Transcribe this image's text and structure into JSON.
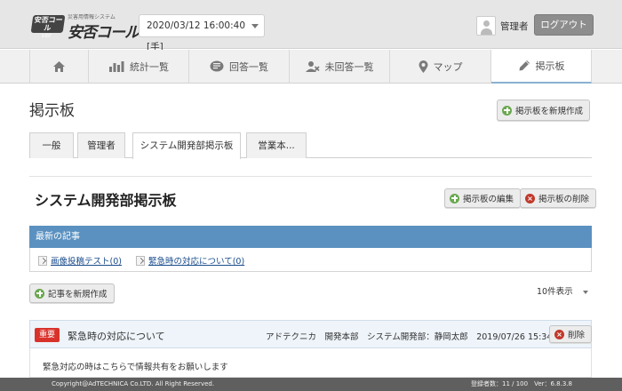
{
  "header": {
    "logo_sub": "災害用情報システム",
    "logo_badge_line1": "安否コール",
    "logo_badge_line2": "ver",
    "logo_main": "安否コール",
    "datetime": "2020/03/12 16:00:40 [手]",
    "user_name": "管理者",
    "logout_label": "ログアウト"
  },
  "nav": {
    "items": [
      {
        "label": "",
        "icon": "home-icon"
      },
      {
        "label": "統計一覧",
        "icon": "bar-chart-icon"
      },
      {
        "label": "回答一覧",
        "icon": "chat-icon"
      },
      {
        "label": "未回答一覧",
        "icon": "user-x-icon"
      },
      {
        "label": "マップ",
        "icon": "map-pin-icon"
      },
      {
        "label": "掲示板",
        "icon": "pencil-icon"
      }
    ]
  },
  "page": {
    "title": "掲示板",
    "create_board_label": "掲示板を新規作成"
  },
  "tabs": [
    "一般",
    "管理者",
    "システム開発部掲示板",
    "営業本..."
  ],
  "board": {
    "title": "システム開発部掲示板",
    "edit_label": "掲示板の編集",
    "delete_label": "掲示板の削除",
    "latest_header": "最新の記事",
    "latest_links": [
      "画像投稿テスト(0)",
      "緊急時の対応について(0)"
    ],
    "create_article_label": "記事を新規作成",
    "per_page": "10件表示"
  },
  "article": {
    "badge": "重要",
    "title": "緊急時の対応について",
    "meta": "アドテクニカ　開発本部　システム開発部：静岡太郎　2019/07/26 15:34:49",
    "delete_label": "削除",
    "body": "緊急対応の時はこちらで情報共有をお願いします"
  },
  "footer": {
    "copyright": "Copyright@AdTECHNICA Co.LTD. All Right Reserved.",
    "info": "登録者数：11 / 100　Ver：6.8.3.8"
  },
  "colors": {
    "accent": "#5b91c0",
    "danger": "#d9322b",
    "success": "#6aa84f"
  }
}
